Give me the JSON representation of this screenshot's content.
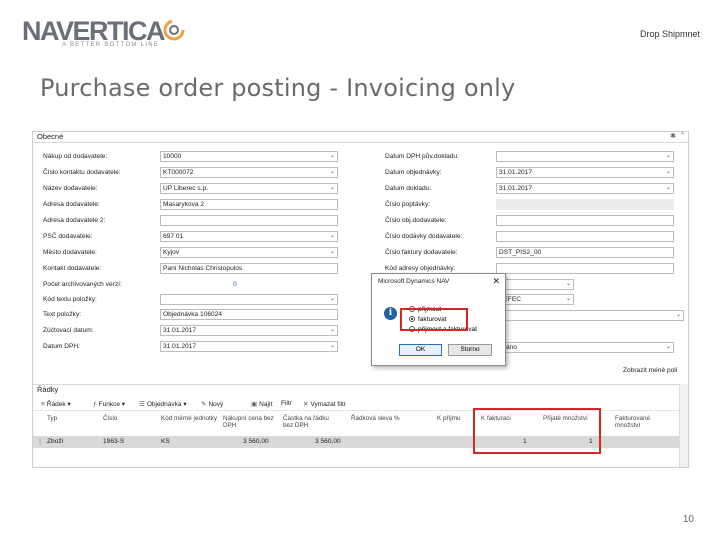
{
  "header": {
    "logo_text": "NAVERTICA",
    "logo_tagline": "A BETTER BOTTOM LINE",
    "top_right": "Drop Shipmnet"
  },
  "slide_title": "Purchase order posting - Invoicing only",
  "page_number": "10",
  "screenshot": {
    "section_title": "Obecné",
    "left_fields": [
      {
        "label": "Nákup od dodavatele:",
        "value": "10000",
        "dropdown": true
      },
      {
        "label": "Číslo kontaktu dodavatele:",
        "value": "KT000072",
        "dropdown": true
      },
      {
        "label": "Název dodavatele:",
        "value": "UP Liberec s.p.",
        "dropdown": true
      },
      {
        "label": "Adresa dodavatele:",
        "value": "Masarykova 2",
        "dropdown": false
      },
      {
        "label": "Adresa dodavatele 2:",
        "value": "",
        "dropdown": false
      },
      {
        "label": "PSČ dodavatele:",
        "value": "697 01",
        "dropdown": true
      },
      {
        "label": "Město dodavatele:",
        "value": "Kyjov",
        "dropdown": true
      },
      {
        "label": "Kontakt dodavatele:",
        "value": "Paní Nicholas Christopulos",
        "dropdown": false
      },
      {
        "label": "Počet archivovaných verzí:",
        "value": "0",
        "dropdown": false
      },
      {
        "label": "Kód textu položky:",
        "value": "",
        "dropdown": true
      },
      {
        "label": "Text položky:",
        "value": "Objednávka 106024",
        "dropdown": false
      },
      {
        "label": "Zúčtovací datum:",
        "value": "31.01.2017",
        "dropdown": true
      },
      {
        "label": "Datum DPH:",
        "value": "31.01.2017",
        "dropdown": true
      }
    ],
    "right_fields": [
      {
        "label": "Datum DPH pův.dokladu:",
        "value": "",
        "dropdown": true
      },
      {
        "label": "Datum objednávky:",
        "value": "31.01.2017",
        "dropdown": true
      },
      {
        "label": "Datum dokladu:",
        "value": "31.01.2017",
        "dropdown": true
      },
      {
        "label": "Číslo poptávky:",
        "value": "",
        "dropdown": false
      },
      {
        "label": "Číslo obj.dodavatele:",
        "value": "",
        "dropdown": false
      },
      {
        "label": "Číslo dodávky dodavatele:",
        "value": "",
        "dropdown": false
      },
      {
        "label": "Číslo faktury dodavatele:",
        "value": "DST_PIS2_00",
        "dropdown": false
      },
      {
        "label": "Kód adresy objednávky:",
        "value": "",
        "dropdown": false
      }
    ],
    "right_extra": [
      {
        "value": "L",
        "dropdown": true
      },
      {
        "value": "EEFEC",
        "dropdown": true
      },
      {
        "value": "",
        "dropdown": true
      },
      {
        "value": "ydáno",
        "dropdown": true
      }
    ],
    "show_fewer_fields": "Zobrazit méně polí",
    "dialog": {
      "title": "Microsoft Dynamics NAV",
      "close": "✕",
      "info_glyph": "i",
      "options": [
        "přijmout",
        "fakturovat",
        "přijmout a fakturovat"
      ],
      "selected_index": 1,
      "ok_label": "OK",
      "cancel_label": "Storno"
    },
    "lines": {
      "title": "Řádky",
      "toolbar": [
        {
          "icon": "≡",
          "label": "Řádek ▾"
        },
        {
          "icon": "ƒ",
          "label": "Funkce ▾"
        },
        {
          "icon": "☰",
          "label": "Objednávka ▾"
        },
        {
          "icon": "✎",
          "label": "Nový"
        },
        {
          "icon": "▣",
          "label": "Najít"
        },
        {
          "icon": "",
          "label": "Filtr"
        },
        {
          "icon": "✕",
          "label": "Vymazat filtr"
        }
      ],
      "columns": [
        "Typ",
        "Číslo",
        "Kód měrné jednotky",
        "Nákupní cena bez DPH",
        "Částka na řádku bez DPH",
        "Řádková sleva %",
        "K příjmu",
        "K fakturaci",
        "Přijaté množství",
        "Fakturované množství"
      ],
      "rows": [
        {
          "typ": "Zboží",
          "cislo": "1963-S",
          "kod": "KS",
          "cena": "3 560,00",
          "castka": "3 560,00",
          "sleva": "",
          "k_prijmu": "",
          "k_fakturaci": "1",
          "prijate": "1",
          "fakturovane": ""
        }
      ]
    }
  }
}
